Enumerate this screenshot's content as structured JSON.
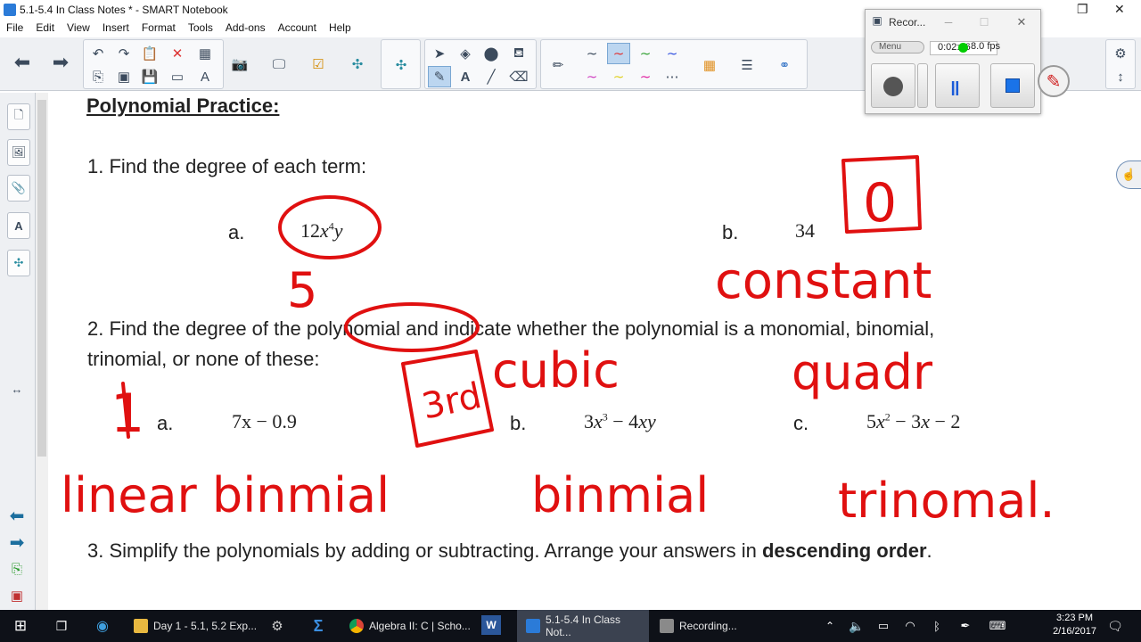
{
  "window": {
    "title": "5.1-5.4 In Class Notes * - SMART Notebook"
  },
  "menu": [
    "File",
    "Edit",
    "View",
    "Insert",
    "Format",
    "Tools",
    "Add-ons",
    "Account",
    "Help"
  ],
  "recorder": {
    "title": "Recor...",
    "menu_label": "Menu",
    "elapsed": "0:02:16",
    "fps": "8.0 fps"
  },
  "doc": {
    "heading": "Polynomial Practice:",
    "q1": "1.  Find the degree of each term:",
    "q1a_label": "a.",
    "q1b_label": "b.",
    "q1b_expr": "34",
    "q2_line1": "2.  Find the degree of the polynomial and indicate whether the polynomial is a monomial, binomial,",
    "q2_line2": "trinomial, or none of these:",
    "q2a_label": "a.",
    "q2a_expr": "7x − 0.9",
    "q2b_label": "b.",
    "q2c_label": "c.",
    "q3_prefix": "3.  Simplify the polynomials by adding or subtracting.  Arrange your answers in ",
    "q3_bold": "descending order",
    "q3_suffix": "."
  },
  "handwriting": {
    "q1a_answer": "5",
    "q1b_answer": "0",
    "q1b_note": "constant",
    "q2a_degree": "1",
    "q2a_type": "linear binmial",
    "q2b_degree": "3rd",
    "q2b_name": "cubic",
    "q2b_type": "binmial",
    "q2c_name": "quadr",
    "q2c_type": "trinomal."
  },
  "ink_color": "#e01010",
  "taskbar": {
    "items": [
      {
        "label": "Day 1 - 5.1, 5.2 Exp...",
        "active": false
      },
      {
        "label": "Algebra II: C | Scho...",
        "active": false
      },
      {
        "label": "5.1-5.4 In Class Not...",
        "active": true
      },
      {
        "label": "Recording...",
        "active": false
      }
    ],
    "time": "3:23 PM",
    "date": "2/16/2017"
  }
}
